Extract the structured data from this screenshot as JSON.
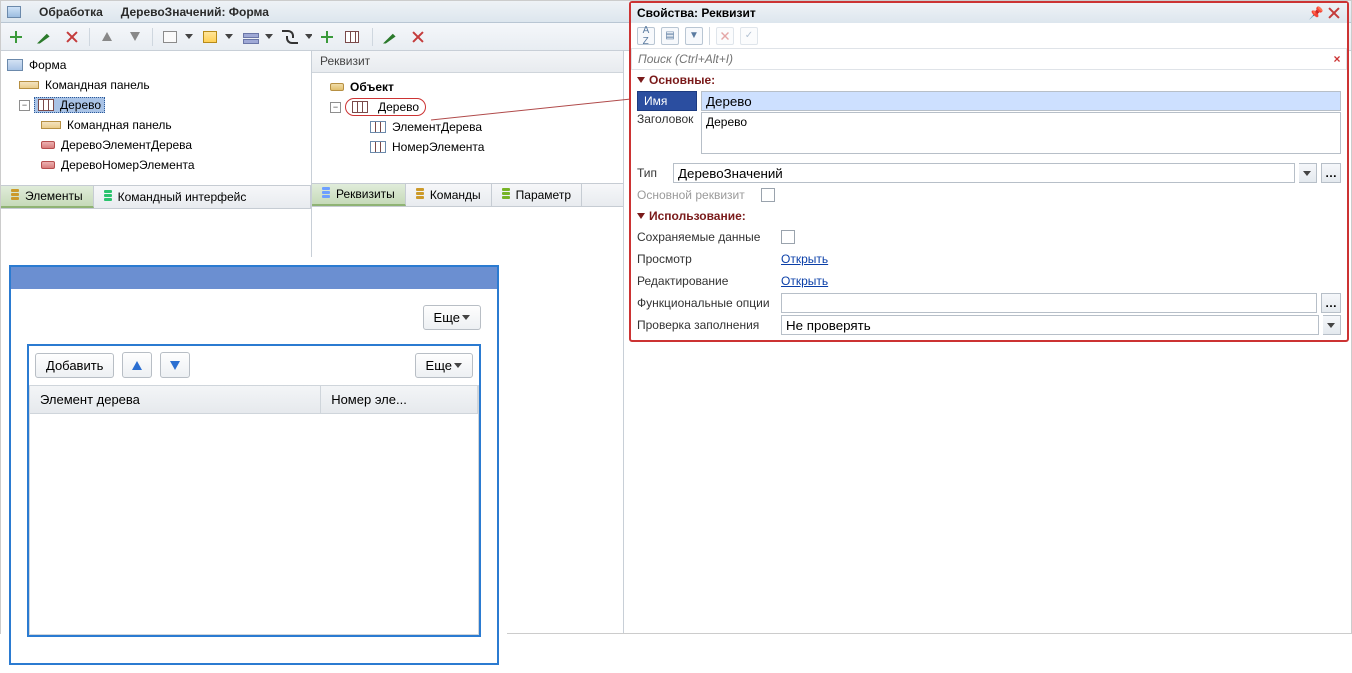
{
  "window": {
    "app_label": "Обработка",
    "doc_label": "ДеревоЗначений: Форма"
  },
  "left_tree": {
    "root": "Форма",
    "cmd_panel": "Командная панель",
    "tree_item": "Дерево",
    "tree_cmd_panel": "Командная панель",
    "col1": "ДеревоЭлементДерева",
    "col2": "ДеревоНомерЭлемента"
  },
  "left_tabs": {
    "elements": "Элементы",
    "cmd_iface": "Командный интерфейс"
  },
  "mid_panel": {
    "header": "Реквизит",
    "root": "Объект",
    "tree": "Дерево",
    "el": "ЭлементДерева",
    "num": "НомерЭлемента"
  },
  "mid_tabs": {
    "req": "Реквизиты",
    "cmd": "Команды",
    "par": "Параметр"
  },
  "preview": {
    "more1": "Еще",
    "add": "Добавить",
    "more2": "Еще",
    "col1": "Элемент дерева",
    "col2": "Номер эле..."
  },
  "props": {
    "title": "Свойства: Реквизит",
    "search_placeholder": "Поиск (Ctrl+Alt+I)",
    "group_main": "Основные:",
    "name_label": "Имя",
    "name_value": "Дерево",
    "title_label": "Заголовок",
    "title_value": "Дерево",
    "type_label": "Тип",
    "type_value": "ДеревоЗначений",
    "main_req_label": "Основной реквизит",
    "group_use": "Использование:",
    "saved_label": "Сохраняемые данные",
    "view_label": "Просмотр",
    "view_link": "Открыть",
    "edit_label": "Редактирование",
    "edit_link": "Открыть",
    "func_label": "Функциональные опции",
    "func_value": "",
    "check_label": "Проверка заполнения",
    "check_value": "Не проверять"
  }
}
